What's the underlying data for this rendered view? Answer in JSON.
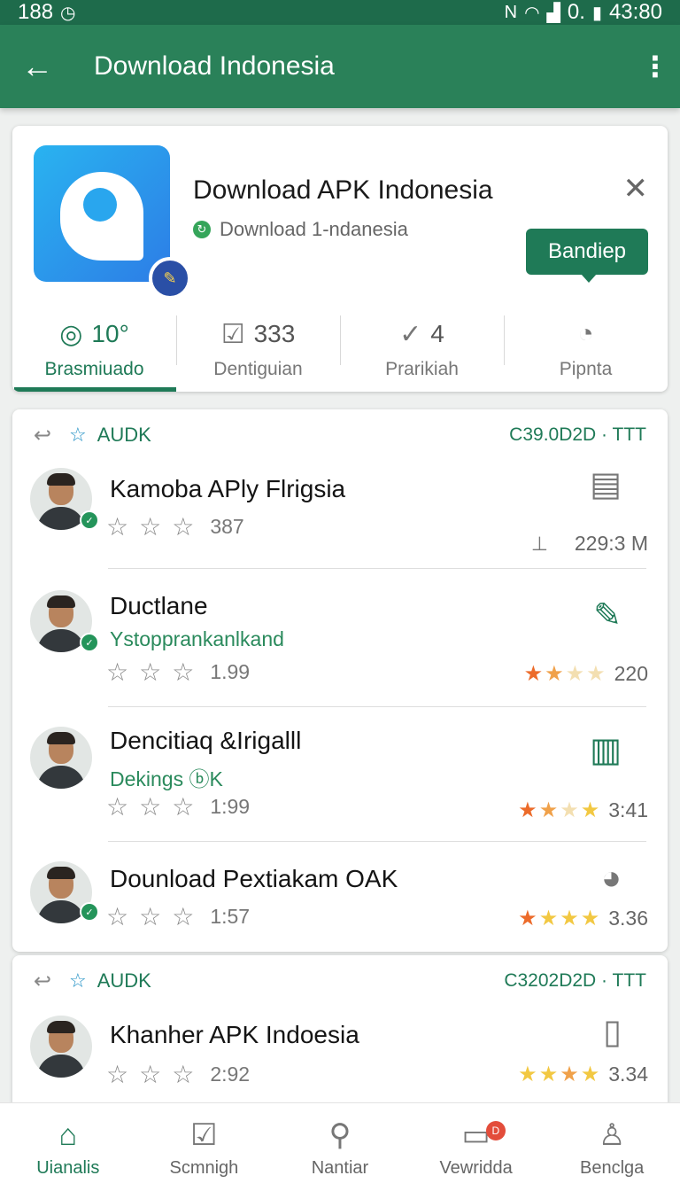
{
  "status_bar": {
    "left_text": "188",
    "right_text": "0.",
    "time": "43:80"
  },
  "app_bar": {
    "title": "Download Indonesia"
  },
  "header_card": {
    "app_title": "Download APK Indonesia",
    "app_subtitle": "Download 1-ndanesia",
    "primary_button": "Bandiep",
    "stats": [
      {
        "value": "10°",
        "label": "Brasmiuado",
        "icon": "gauge-icon"
      },
      {
        "value": "333",
        "label": "Dentiguian",
        "icon": "chart-icon"
      },
      {
        "value": "4",
        "label": "Prarikiah",
        "icon": "check-badge-icon"
      },
      {
        "value": "",
        "label": "Pipnta",
        "icon": "timer-icon"
      }
    ]
  },
  "sections": [
    {
      "tag": "AUDK",
      "code": "C39.0D2D · TTT",
      "items": [
        {
          "name": "Kamoba APly Flrigsia",
          "subtitle": "",
          "count": "387",
          "right_value": "229:3 M",
          "right_icon": "document-icon",
          "rating": 0
        },
        {
          "name": "Ductlane",
          "subtitle": "Ystopprankanlkand",
          "count": "1.99",
          "right_value": "220",
          "right_icon": "brush-icon",
          "rating": 2
        },
        {
          "name": "Dencitiaq &Irigalll",
          "subtitle": "Dekings ⓑK",
          "count": "1:99",
          "right_value": "3:41",
          "right_icon": "news-icon",
          "rating": 3
        },
        {
          "name": "Dounload Pextiakam OAK",
          "subtitle": "",
          "count": "1:57",
          "right_value": "3.36",
          "right_icon": "pie-icon",
          "rating": 4
        }
      ]
    },
    {
      "tag": "AUDK",
      "code": "C3202D2D · TTT",
      "items": [
        {
          "name": "Khanher APK Indoesia",
          "subtitle": "",
          "count": "2:92",
          "right_value": "3.34",
          "right_icon": "phone-icon",
          "rating": 4
        }
      ]
    }
  ],
  "bottom_nav": [
    {
      "label": "Uianalis",
      "icon": "home-icon",
      "active": true
    },
    {
      "label": "Scmnigh",
      "icon": "chart-icon",
      "active": false
    },
    {
      "label": "Nantiar",
      "icon": "search-icon",
      "active": false
    },
    {
      "label": "Vewridda",
      "icon": "chat-icon",
      "active": false,
      "badge": "D"
    },
    {
      "label": "Benclga",
      "icon": "person-icon",
      "active": false
    }
  ],
  "colors": {
    "primary": "#1f7a57",
    "appbar": "#2a8159",
    "star_orange": "#ec6b2a",
    "star_yellow": "#f2c842"
  }
}
